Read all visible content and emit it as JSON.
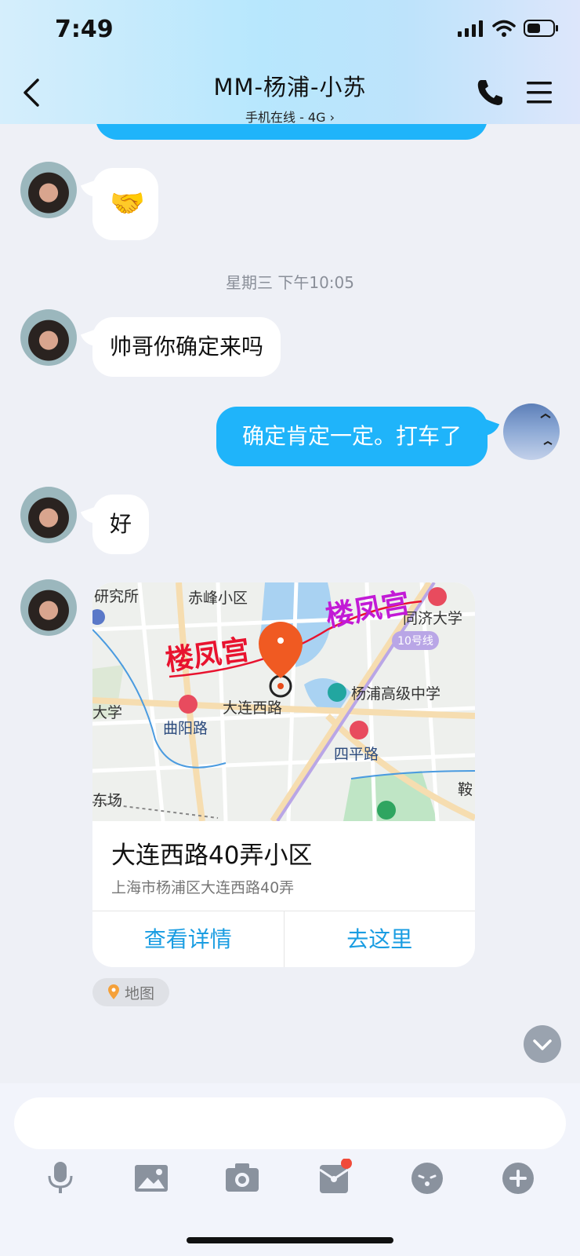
{
  "status_bar": {
    "time": "7:49"
  },
  "header": {
    "title": "MM-杨浦-小苏",
    "subtitle": "手机在线 - 4G",
    "subtitle_chevron": "›"
  },
  "messages": [
    {
      "from": "contact",
      "type": "emoji",
      "emoji": "🤝"
    },
    {
      "type": "timestamp",
      "text": "星期三 下午10:05"
    },
    {
      "from": "contact",
      "type": "text",
      "text": "帅哥你确定来吗"
    },
    {
      "from": "me",
      "type": "text",
      "text": "确定肯定一定。打车了"
    },
    {
      "from": "contact",
      "type": "text",
      "text": "好"
    },
    {
      "from": "contact",
      "type": "location",
      "map_labels": {
        "watermark": "楼凤宫",
        "labels": [
          "研究所",
          "赤峰小区",
          "同济大学",
          "10号线",
          "杨浦高级中学",
          "大连西路",
          "曲阳路",
          "四平路",
          "大学",
          "鞍",
          "东场"
        ]
      },
      "place_name": "大连西路40弄小区",
      "address": "上海市杨浦区大连西路40弄",
      "actions": [
        "查看详情",
        "去这里"
      ],
      "tag": "地图"
    }
  ],
  "colors": {
    "accent": "#1fb4fa",
    "link": "#1a9de2",
    "background": "#eef0f6"
  },
  "toolbar": {
    "icons": [
      "microphone-icon",
      "image-icon",
      "camera-icon",
      "red-packet-icon",
      "emoji-icon",
      "plus-icon"
    ]
  }
}
